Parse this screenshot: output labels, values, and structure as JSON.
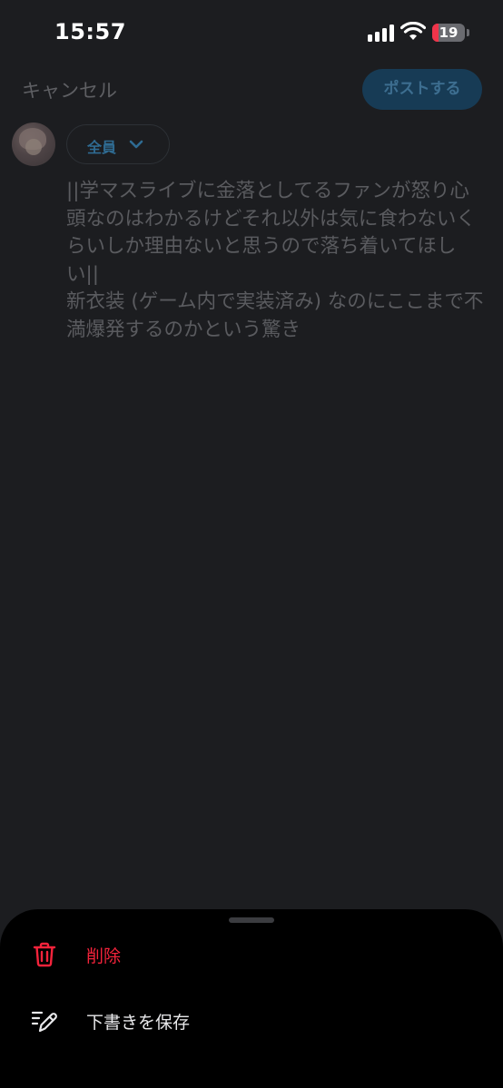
{
  "status_bar": {
    "time": "15:57",
    "battery_level": "19",
    "battery_fraction": 0.19,
    "battery_color": "#f0344a",
    "icons": [
      "signal-icon",
      "wifi-icon",
      "battery-icon"
    ]
  },
  "header": {
    "cancel_label": "キャンセル",
    "post_label": "ポストする"
  },
  "composer": {
    "audience_label": "全員",
    "draft_text": "||学マスライブに金落としてるファンが怒り心頭なのはわかるけどそれ以外は気に食わないくらいしか理由ないと思うので落ち着いてほしい||\n新衣装 (ゲーム内で実装済み) なのにここまで不満爆発するのかという驚き"
  },
  "sheet": {
    "items": [
      {
        "label": "削除",
        "icon": "trash-icon",
        "color": "#f4233b"
      },
      {
        "label": "下書きを保存",
        "icon": "edit-pen-icon",
        "color": "#e8e8ea"
      }
    ]
  },
  "colors": {
    "background": "#1c1d20",
    "sheet_background": "#000000",
    "accent": "#2f6b92",
    "destructive": "#f4233b"
  }
}
